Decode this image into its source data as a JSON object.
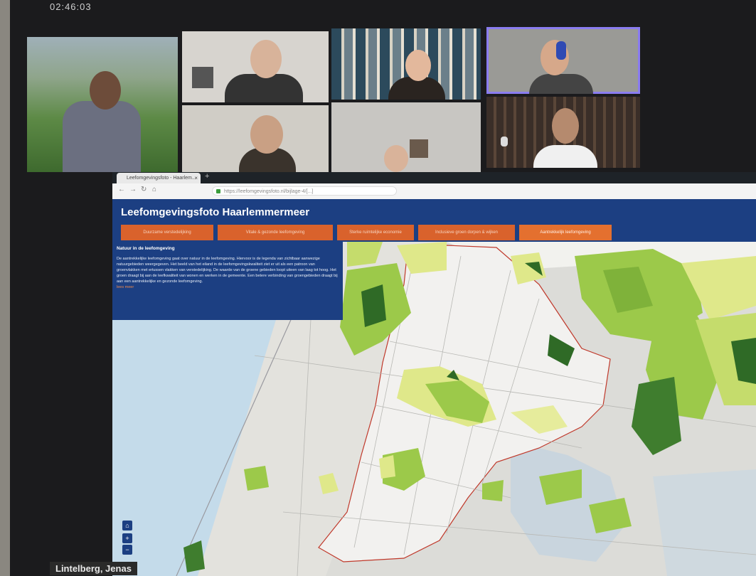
{
  "meeting": {
    "timer": "02:46:03",
    "participant_caption": "Lintelberg, Jenas"
  },
  "browser": {
    "tab_title": "Leefomgevingsfoto - Haarlem...",
    "url": "https://leefomgevingsfoto.nl/bijlage-4/[...]"
  },
  "site": {
    "title": "Leefomgevingsfoto Haarlemmermeer",
    "menu": [
      {
        "label": "Duurzame verstedelijking"
      },
      {
        "label": "Vitale & gezonde leefomgeving"
      },
      {
        "label": "Sterke ruimtelijke economie"
      },
      {
        "label": "Inclusieve groen dorpen & wijken"
      },
      {
        "label": "Aantrekkelijk leefomgeving"
      }
    ],
    "info_panel": {
      "heading": "Natuur in de leefomgeving",
      "body": "De aantrekkelijke leefomgeving gaat over natuur in de leefomgeving. Hiervoor is de legenda van zichtbaar aanwezige natuurgebieden weergegeven. Het beeld van het eiland in de leefomgevingskwaliteit ziet er uit als een patroon van groenvlakken met ertussen vlakken van verstedelijking. De waarde van de groene gebieden loopt uiteen van laag tot hoog. Het groen draagt bij aan de leefkwaliteit van wonen en werken in de gemeente. Een betere verbinding van groengebieden draagt bij aan een aantrekkelijke en gezonde leefomgeving.",
      "link_text": "lees meer"
    }
  },
  "map": {
    "colors": {
      "water": "#c4dbea",
      "land": "#dcdcd8",
      "polder": "#f2f1ef",
      "green_light": "#dfe88a",
      "green_mid": "#9cc94a",
      "green_dark": "#2f6a26",
      "boundary": "#c0392b"
    },
    "controls": [
      "home-icon",
      "zoom-in-icon",
      "zoom-out-icon"
    ]
  }
}
